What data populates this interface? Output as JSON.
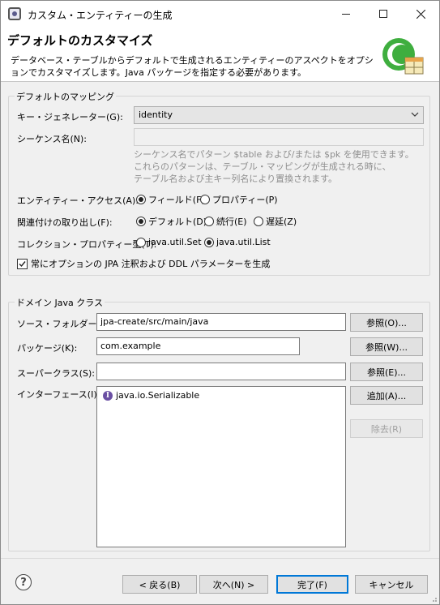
{
  "window": {
    "title": "カスタム・エンティティーの生成"
  },
  "banner": {
    "title": "デフォルトのカスタマイズ",
    "description": "データベース・テーブルからデフォルトで生成されるエンティティーのアスペクトをオプションでカスタマイズします。Java パッケージを指定する必要があります。",
    "logo_icon": "eclipse-jpa-wizard-icon"
  },
  "mapping": {
    "legend": "デフォルトのマッピング",
    "key_generator_label": "キー・ジェネレーター(G):",
    "key_generator_value": "identity",
    "sequence_label": "シーケンス名(N):",
    "sequence_value": "",
    "hint_lines": [
      "シーケンス名でパターン $table および/または $pk を使用できます。",
      "これらのパターンは、テーブル・マッピングが生成される時に、",
      "テーブル名および主キー列名により置換されます。"
    ],
    "entity_access_label": "エンティティー・アクセス(A):",
    "entity_access_options": [
      "フィールド(F)",
      "プロパティー(P)"
    ],
    "entity_access_selected": 0,
    "fetch_label": "関連付けの取り出し(F):",
    "fetch_options": [
      "デフォルト(D)",
      "続行(E)",
      "遅延(Z)"
    ],
    "fetch_selected": 0,
    "collection_label": "コレクション・プロパティー型(T):",
    "collection_options": [
      "java.util.Set",
      "java.util.List"
    ],
    "collection_selected": 1,
    "always_generate_label": "常にオプションの JPA 注釈および DDL パラメーターを生成",
    "always_generate_checked": true
  },
  "domain": {
    "legend": "ドメイン Java クラス",
    "source_folder_label": "ソース・フォルダー(D):",
    "source_folder_value": "jpa-create/src/main/java",
    "source_browse_label": "参照(O)...",
    "package_label": "パッケージ(K):",
    "package_value": "com.example",
    "package_browse_label": "参照(W)...",
    "superclass_label": "スーパークラス(S):",
    "superclass_value": "",
    "superclass_browse_label": "参照(E)...",
    "interfaces_label": "インターフェース(I):",
    "interfaces": [
      "java.io.Serializable"
    ],
    "add_label": "追加(A)...",
    "remove_label": "除去(R)"
  },
  "footer": {
    "back_label": "< 戻る(B)",
    "next_label": "次へ(N) >",
    "finish_label": "完了(F)",
    "cancel_label": "キャンセル"
  }
}
